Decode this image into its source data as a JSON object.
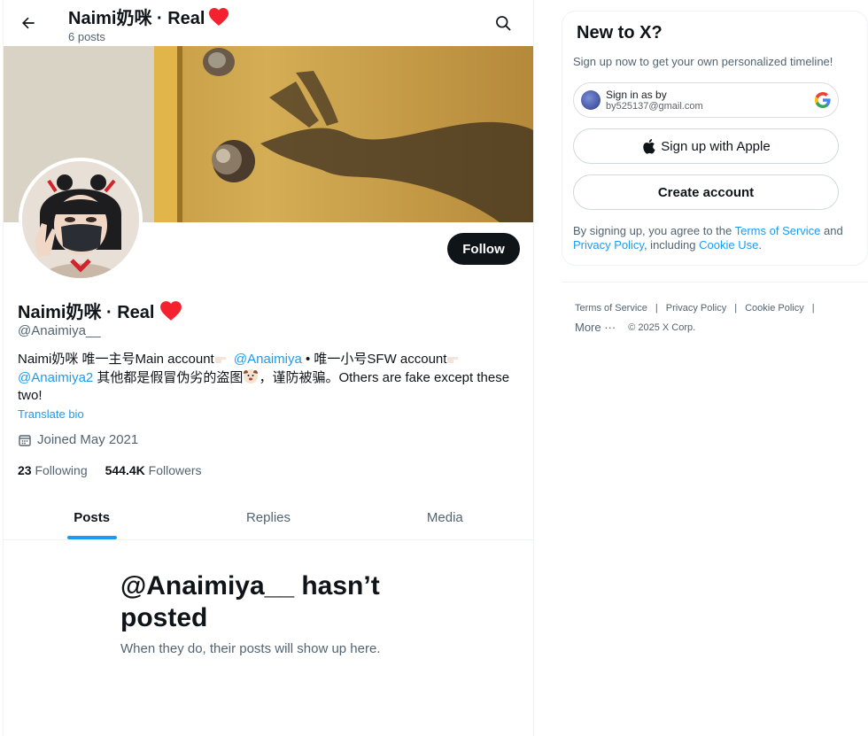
{
  "header": {
    "title": "Naimi奶咪 · Real",
    "post_count": "6 posts"
  },
  "profile": {
    "name": "Naimi奶咪 · Real",
    "handle": "@Anaimiya__",
    "follow_label": "Follow",
    "bio": {
      "part1": "Naimi奶咪 唯一主号Main account",
      "mention1": "@Anaimiya",
      "part2": " • 唯一小号SFW account",
      "mention2": "@Anaimiya2",
      "part3": " 其他都是假冒伪劣的盗图",
      "part4": "，谨防被骗。Others are fake except these two!"
    },
    "translate_label": "Translate bio",
    "joined": "Joined May 2021",
    "following_count": "23",
    "following_label": "Following",
    "followers_count": "544.4K",
    "followers_label": "Followers"
  },
  "tabs": [
    {
      "label": "Posts",
      "active": true
    },
    {
      "label": "Replies",
      "active": false
    },
    {
      "label": "Media",
      "active": false
    }
  ],
  "empty_state": {
    "title": "@Anaimiya__ hasn’t posted",
    "subtitle": "When they do, their posts will show up here."
  },
  "signup": {
    "title": "New to X?",
    "subtitle": "Sign up now to get your own personalized timeline!",
    "google_line1": "Sign in as by",
    "google_line2": "by525137@gmail.com",
    "apple_label": "Sign up with Apple",
    "create_label": "Create account",
    "terms_prefix": "By signing up, you agree to the ",
    "terms_link": "Terms of Service",
    "terms_mid": " and ",
    "privacy_link": "Privacy Policy",
    "terms_mid2": ", including ",
    "cookie_link": "Cookie Use",
    "terms_end": "."
  },
  "footer": {
    "links": [
      "Terms of Service",
      "Privacy Policy",
      "Cookie Policy"
    ],
    "more": "More ···",
    "copyright": "© 2025 X Corp."
  },
  "colors": {
    "accent": "#1d9bf0",
    "text": "#0f1419",
    "muted": "#536471",
    "heart": "#f4212e"
  }
}
